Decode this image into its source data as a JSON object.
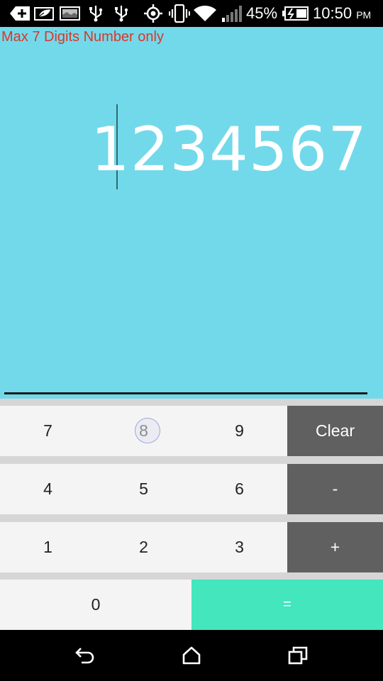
{
  "status_bar": {
    "battery_percent": "45%",
    "time": "10:50",
    "ampm": "PM",
    "icons": [
      "add-notification-icon",
      "leaf-icon",
      "image-icon",
      "usb-icon",
      "usb-icon",
      "gps-icon",
      "vibrate-icon",
      "wifi-icon",
      "signal-icon",
      "battery-charging-icon"
    ]
  },
  "display": {
    "hint": "Max 7 Digits Number only",
    "value": "1234567"
  },
  "keypad": {
    "row1": [
      "7",
      "8",
      "9"
    ],
    "row2": [
      "4",
      "5",
      "6"
    ],
    "row3": [
      "1",
      "2",
      "3"
    ],
    "zero": "0",
    "clear": "Clear",
    "minus": "-",
    "plus": "+",
    "equals": "="
  },
  "colors": {
    "display_bg": "#72d9ea",
    "hint": "#d9372a",
    "operator_bg": "#606060",
    "equals_bg": "#43e6bd",
    "digit_bg": "#f4f4f4"
  },
  "nav_bar": {
    "icons": [
      "back-icon",
      "home-icon",
      "recents-icon"
    ]
  }
}
